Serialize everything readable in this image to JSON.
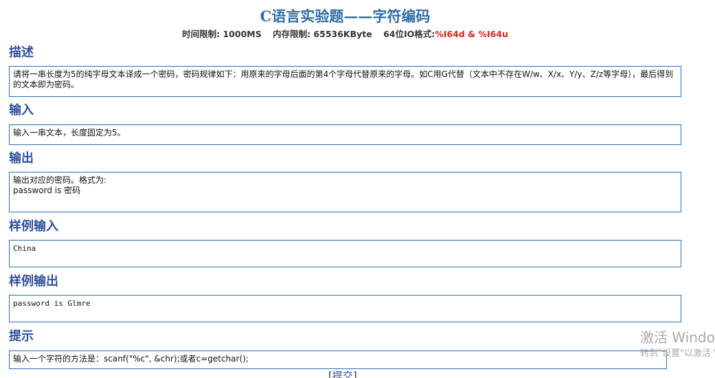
{
  "problem": {
    "title": "C语言实验题——字符编码",
    "time_limit_label": "时间限制:",
    "time_limit_value": "1000MS",
    "memory_limit_label": "内存限制:",
    "memory_limit_value": "65536KByte",
    "io_format_label": "64位IO格式:",
    "io_format_value": "%I64d & %I64u"
  },
  "sections": {
    "description": {
      "heading": "描述",
      "text": "请将一串长度为5的纯字母文本译成一个密码，密码规律如下：用原来的字母后面的第4个字母代替原来的字母。如C用G代替（文本中不存在W/w、X/x、Y/y、Z/z等字母），最后得到的文本即为密码。"
    },
    "input": {
      "heading": "输入",
      "text": "输入一串文本，长度固定为5。"
    },
    "output": {
      "heading": "输出",
      "text": "输出对应的密码。格式为:\npassword is 密码"
    },
    "sample_input": {
      "heading": "样例输入",
      "text": "China"
    },
    "sample_output": {
      "heading": "样例输出",
      "text": "password is Glmre"
    },
    "hint": {
      "heading": "提示",
      "text": "输入一个字符的方法是：scanf(\"%c\", &chr);或者c=getchar();"
    }
  },
  "actions": {
    "submit_open": "[",
    "submit_label": "提交",
    "submit_close": "]"
  },
  "watermark": {
    "title": "激活 Windows",
    "subtitle": "转到\"设置\"以激活 Windows。"
  }
}
